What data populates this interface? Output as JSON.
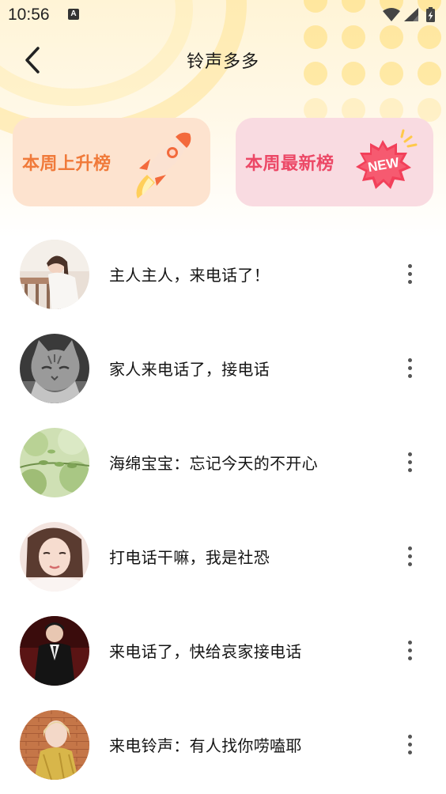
{
  "status_bar": {
    "time": "10:56",
    "notification_icon": "a-icon",
    "wifi_icon": "wifi-icon",
    "signal_icon": "signal-icon",
    "battery_icon": "battery-charging-icon"
  },
  "header": {
    "back_icon": "chevron-left-icon",
    "title": "铃声多多"
  },
  "cards": {
    "rise": {
      "label": "本周上升榜",
      "icon": "rocket-icon",
      "background": "#fde3cf",
      "text_color": "#f07a3a"
    },
    "new": {
      "label": "本周最新榜",
      "icon": "new-badge-icon",
      "badge_text": "NEW",
      "background": "#f9dbe1",
      "text_color": "#ec4866"
    }
  },
  "ringtones": [
    {
      "title": "主人主人，来电话了！",
      "avatar": "girl-photo"
    },
    {
      "title": "家人来电话了，接电话",
      "avatar": "cat-photo"
    },
    {
      "title": "海绵宝宝：忘记今天的不开心",
      "avatar": "leaves-photo"
    },
    {
      "title": "打电话干嘛，我是社恐",
      "avatar": "woman-photo"
    },
    {
      "title": "来电话了，快给哀家接电话",
      "avatar": "man-suit-photo"
    },
    {
      "title": "来电铃声：有人找你唠嗑耶",
      "avatar": "woman-dress-photo"
    }
  ],
  "more_icon": "more-vertical-icon"
}
